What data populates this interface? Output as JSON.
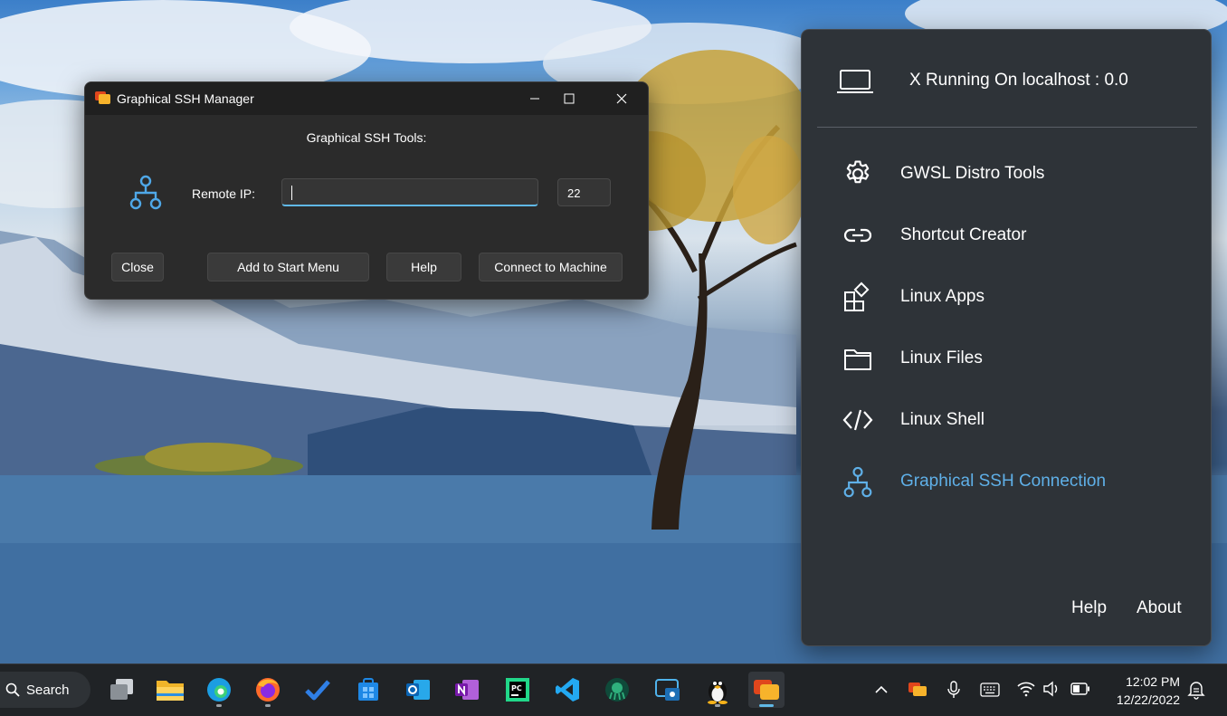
{
  "ssh_window": {
    "title": "Graphical SSH Manager",
    "heading": "Graphical SSH Tools:",
    "remote_ip_label": "Remote IP:",
    "remote_ip_value": "",
    "port_value": "22",
    "buttons": {
      "close": "Close",
      "add_start_menu": "Add to Start Menu",
      "help": "Help",
      "connect": "Connect to Machine"
    }
  },
  "gwsl_panel": {
    "status": "X Running On localhost : 0.0",
    "menu": [
      {
        "label": "GWSL Distro Tools",
        "icon": "gear-icon"
      },
      {
        "label": "Shortcut Creator",
        "icon": "link-icon"
      },
      {
        "label": "Linux Apps",
        "icon": "apps-icon"
      },
      {
        "label": "Linux Files",
        "icon": "folder-icon"
      },
      {
        "label": "Linux Shell",
        "icon": "code-icon"
      },
      {
        "label": "Graphical SSH Connection",
        "icon": "network-icon",
        "active": true
      }
    ],
    "help": "Help",
    "about": "About",
    "accent_color": "#5fb0e8"
  },
  "taskbar": {
    "search_label": "Search",
    "apps": [
      "task-view",
      "file-explorer",
      "edge",
      "firefox",
      "todo",
      "store",
      "outlook",
      "onenote",
      "pycharm",
      "vscode",
      "gitkraken",
      "remote-desktop",
      "linux",
      "gwsl"
    ],
    "clock_time": "12:02 PM",
    "clock_date": "12/22/2022"
  }
}
